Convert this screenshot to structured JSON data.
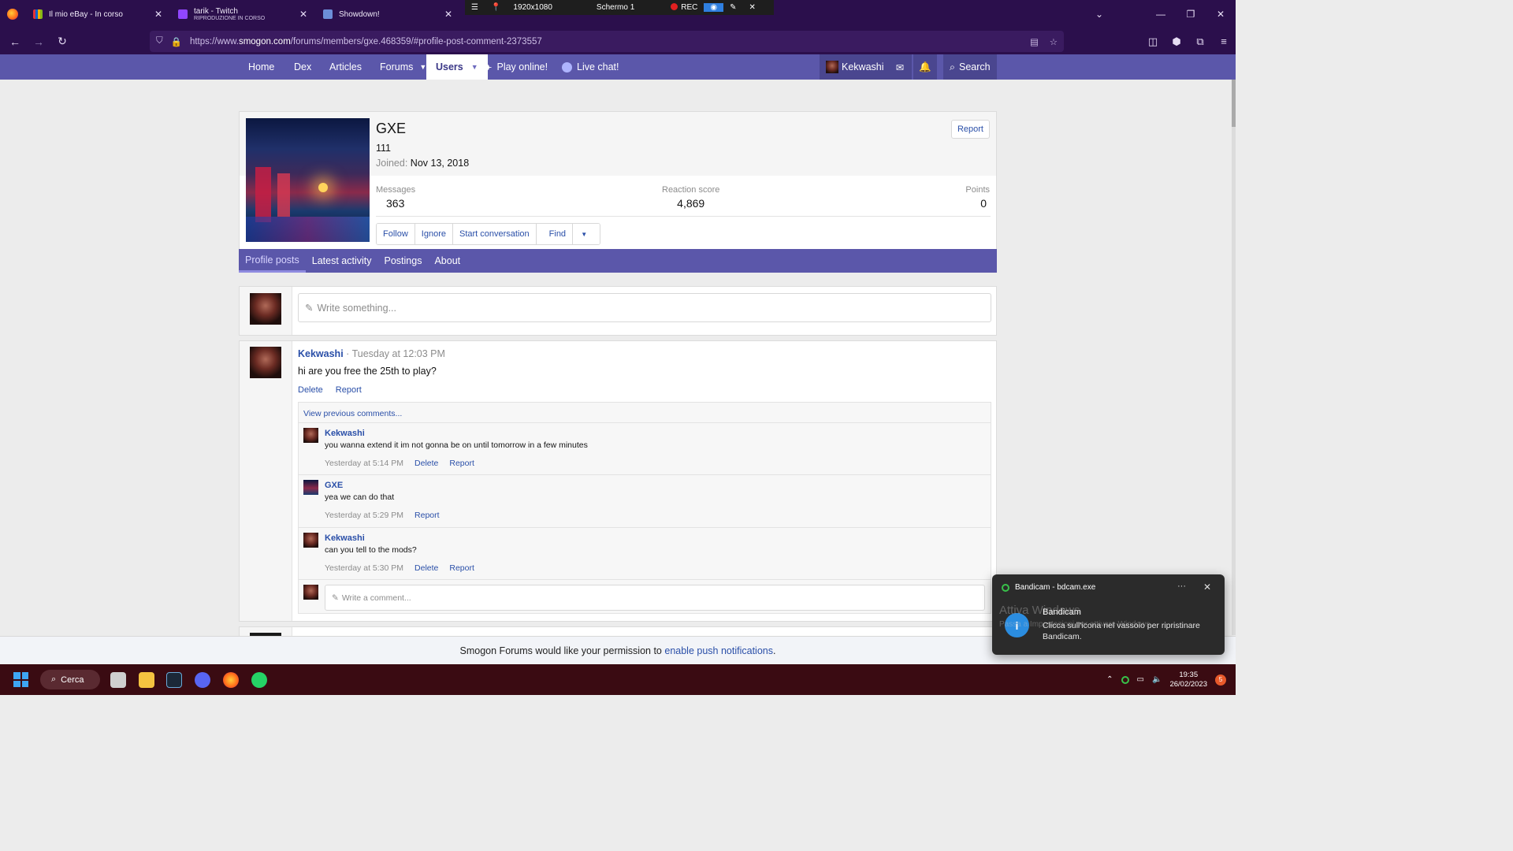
{
  "browser": {
    "tabs": [
      {
        "title": "Il mio eBay - In corso",
        "subtitle": "",
        "favicon_color": "#e53238"
      },
      {
        "title": "tarik - Twitch",
        "subtitle": "RIPRODUZIONE IN CORSO",
        "favicon_color": "#9146ff"
      },
      {
        "title": "Showdown!",
        "subtitle": "",
        "favicon_color": "#6c8ed8"
      }
    ],
    "url_prefix": "https://www.",
    "url_domain": "smogon.com",
    "url_path": "/forums/members/gxe.468359/#profile-post-comment-2373557"
  },
  "recorder": {
    "resolution": "1920x1080",
    "screen": "Schermo 1",
    "rec": "REC"
  },
  "site_nav": {
    "home": "Home",
    "dex": "Dex",
    "articles": "Articles",
    "forums": "Forums",
    "users": "Users",
    "play": "Play online!",
    "chat": "Live chat!",
    "account": "Kekwashi",
    "search": "Search"
  },
  "profile": {
    "name": "GXE",
    "user_title": "111",
    "joined_label": "Joined:",
    "joined_value": "Nov 13, 2018",
    "report": "Report",
    "stats": [
      {
        "label": "Messages",
        "value": "363"
      },
      {
        "label": "Reaction score",
        "value": "4,869"
      },
      {
        "label": "Points",
        "value": "0"
      }
    ],
    "buttons": {
      "follow": "Follow",
      "ignore": "Ignore",
      "start": "Start conversation",
      "find": "Find"
    },
    "tabs": [
      "Profile posts",
      "Latest activity",
      "Postings",
      "About"
    ]
  },
  "compose": {
    "placeholder": "Write something..."
  },
  "post": {
    "author": "Kekwashi",
    "time": "· Tuesday at 12:03 PM",
    "text": "hi are you free the 25th to play?",
    "delete": "Delete",
    "report": "Report",
    "view_previous": "View previous comments...",
    "comments": [
      {
        "author": "Kekwashi",
        "text": "you wanna extend it im not gonna be on until tomorrow in a few minutes",
        "time": "Yesterday at 5:14 PM",
        "delete": "Delete",
        "report": "Report"
      },
      {
        "author": "GXE",
        "text": "yea we can do that",
        "time": "Yesterday at 5:29 PM",
        "report": "Report"
      },
      {
        "author": "Kekwashi",
        "text": "can you tell to the mods?",
        "time": "Yesterday at 5:30 PM",
        "delete": "Delete",
        "report": "Report"
      }
    ],
    "comment_placeholder": "Write a comment..."
  },
  "push_bar": {
    "text": "Smogon Forums would like your permission to",
    "link": "enable push notifications",
    "end": "."
  },
  "toast": {
    "app": "Bandicam - bdcam.exe",
    "title": "Bandicam",
    "body": "Clicca sull'icona nel vassoio per ripristinare Bandicam.",
    "watermark": "Attiva Windows",
    "watermark2": "Passa a Impostazioni per attivare Windows."
  },
  "taskbar": {
    "search": "Cerca",
    "time": "19:35",
    "date": "26/02/2023",
    "badge": "5"
  }
}
